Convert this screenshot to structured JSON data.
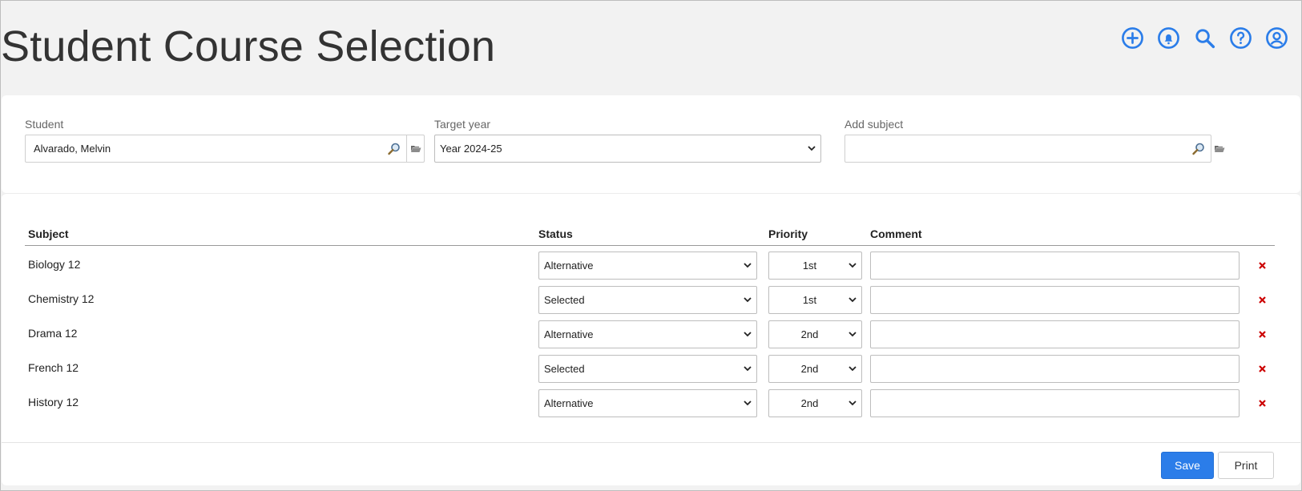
{
  "header": {
    "title": "Student Course Selection",
    "accent_color": "#2b7de9",
    "icons": [
      "add-circle-icon",
      "bell-icon",
      "search-icon",
      "help-icon",
      "account-icon"
    ]
  },
  "filters": {
    "student": {
      "label": "Student",
      "value": "Alvarado, Melvin"
    },
    "target_year": {
      "label": "Target year",
      "value": "Year 2024-25"
    },
    "add_subject": {
      "label": "Add subject",
      "value": ""
    }
  },
  "table": {
    "headers": {
      "subject": "Subject",
      "status": "Status",
      "priority": "Priority",
      "comment": "Comment"
    },
    "rows": [
      {
        "subject": "Biology 12",
        "status": "Alternative",
        "priority": "1st",
        "comment": ""
      },
      {
        "subject": "Chemistry 12",
        "status": "Selected",
        "priority": "1st",
        "comment": ""
      },
      {
        "subject": "Drama 12",
        "status": "Alternative",
        "priority": "2nd",
        "comment": ""
      },
      {
        "subject": "French 12",
        "status": "Selected",
        "priority": "2nd",
        "comment": ""
      },
      {
        "subject": "History 12",
        "status": "Alternative",
        "priority": "2nd",
        "comment": ""
      }
    ]
  },
  "footer": {
    "save_label": "Save",
    "print_label": "Print",
    "delete_color": "#cc0000"
  }
}
